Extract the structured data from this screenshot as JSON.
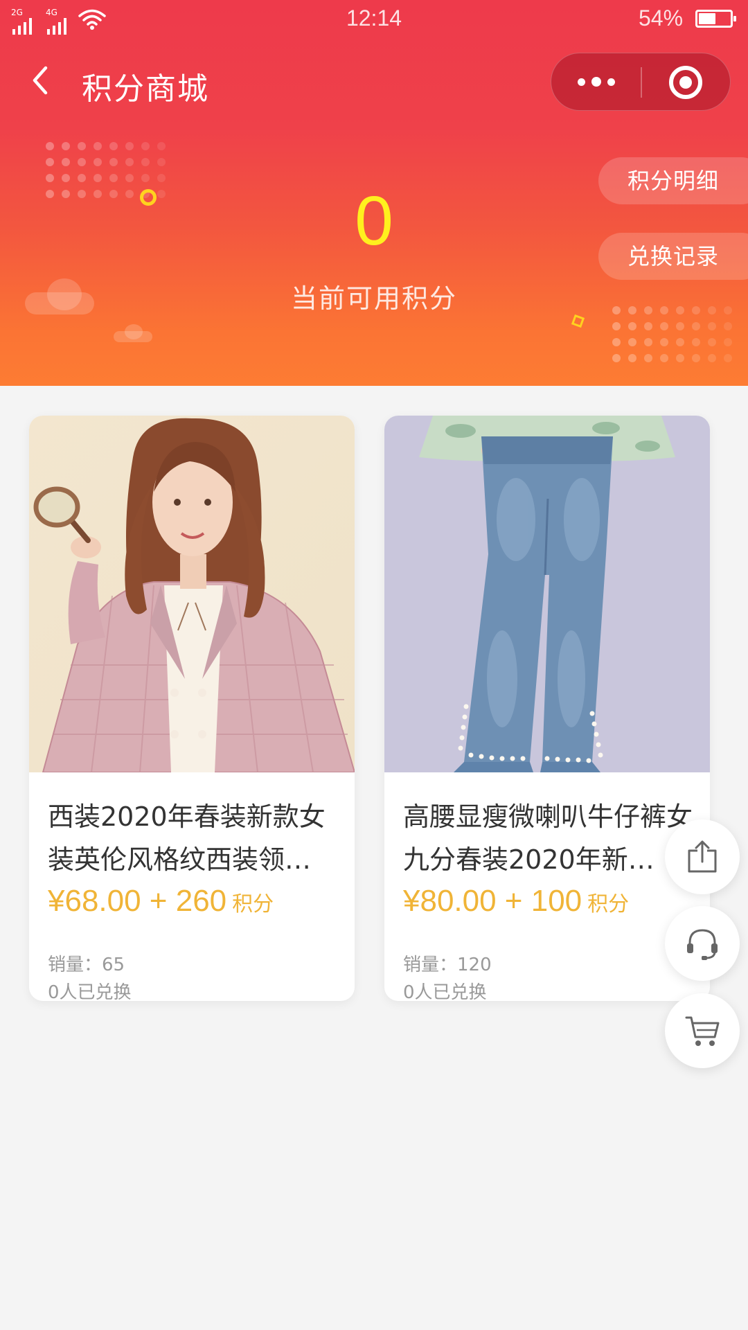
{
  "status_bar": {
    "signal_1": "2G",
    "signal_2": "4G",
    "time": "12:14",
    "battery_pct": "54%",
    "battery_level": 0.54,
    "wifi_icon": "wifi-icon"
  },
  "nav": {
    "title": "积分商城",
    "back_icon": "chevron-left-icon",
    "more_icon": "more-dots-icon",
    "close_icon": "target-icon"
  },
  "points": {
    "value": "0",
    "label": "当前可用积分",
    "detail_button": "积分明细",
    "record_button": "兑换记录"
  },
  "products": [
    {
      "title": "西装2020年春装新款女装英伦风格纹西装领…",
      "price": "¥68.00 + 260",
      "points_unit": "积分",
      "sales": "销量：65",
      "exchanged": "0人已兑换"
    },
    {
      "title": "高腰显瘦微喇叭牛仔裤女九分春装2020年新…",
      "price": "¥80.00 + 100",
      "points_unit": "积分",
      "sales": "销量：120",
      "exchanged": "0人已兑换"
    }
  ],
  "floating_actions": [
    "share-icon",
    "headset-icon",
    "cart-icon"
  ],
  "colors": {
    "header_top": "#ee3a4b",
    "header_bottom": "#fd7c33",
    "points_value": "#fff01e",
    "price": "#f0b437",
    "background": "#f4f4f4"
  }
}
